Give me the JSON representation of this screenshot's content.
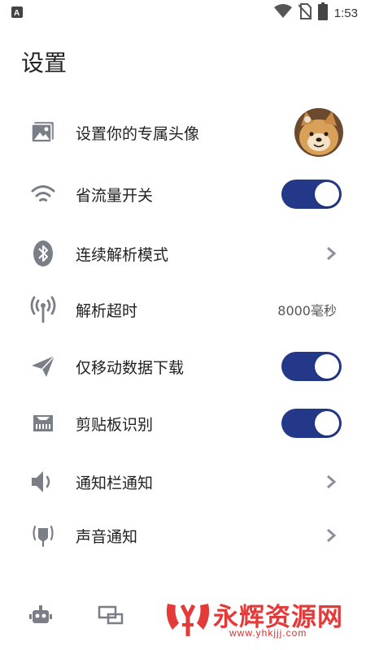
{
  "status_bar": {
    "time": "1:53",
    "notification_icon": "app-notification-icon",
    "icons": [
      "wifi-icon",
      "no-sim-icon",
      "battery-icon"
    ]
  },
  "page": {
    "title": "设置"
  },
  "settings": [
    {
      "id": "avatar",
      "label": "设置你的专属头像",
      "icon": "image-icon",
      "control": "avatar"
    },
    {
      "id": "data-saver",
      "label": "省流量开关",
      "icon": "wifi-icon",
      "control": "toggle",
      "on": true
    },
    {
      "id": "continuous-parse",
      "label": "连续解析模式",
      "icon": "bluetooth-icon",
      "control": "chevron"
    },
    {
      "id": "parse-timeout",
      "label": "解析超时",
      "icon": "broadcast-icon",
      "control": "value",
      "value": "8000毫秒"
    },
    {
      "id": "mobile-only",
      "label": "仅移动数据下载",
      "icon": "send-icon",
      "control": "toggle",
      "on": true
    },
    {
      "id": "clipboard",
      "label": "剪贴板识别",
      "icon": "memory-icon",
      "control": "toggle",
      "on": true
    },
    {
      "id": "notification-bar",
      "label": "通知栏通知",
      "icon": "speaker-icon",
      "control": "chevron"
    },
    {
      "id": "sound-notify",
      "label": "声音通知",
      "icon": "microphone-icon",
      "control": "chevron"
    }
  ],
  "bottom_nav": [
    "robot-icon",
    "devices-icon"
  ],
  "watermark": {
    "text": "永辉资源网",
    "url": "www.yhkjjj.com"
  },
  "colors": {
    "toggle_on": "#24388a",
    "icon": "#7a7f87",
    "watermark": "#e33a3a"
  }
}
